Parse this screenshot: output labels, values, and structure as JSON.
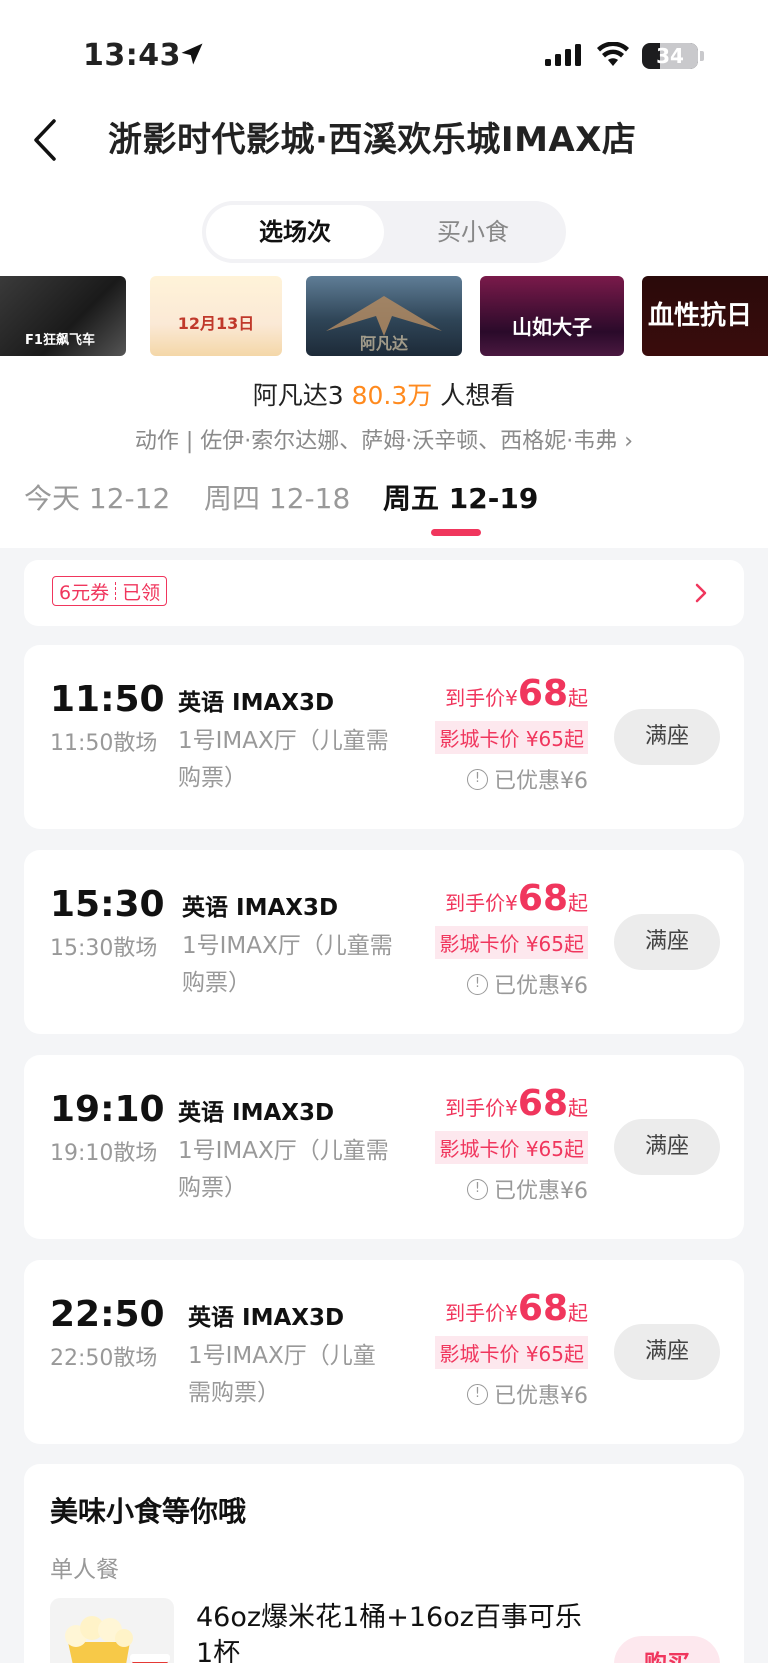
{
  "status_bar": {
    "time": "13:43",
    "battery": "34"
  },
  "header": {
    "title": "浙影时代影城·西溪欢乐城IMAX店"
  },
  "segments": {
    "active": "选场次",
    "inactive": "买小食"
  },
  "posters": [
    {
      "label": "F1狂飙飞车"
    },
    {
      "label": "12月13日"
    },
    {
      "label": "阿凡达"
    },
    {
      "label": "山如大子"
    },
    {
      "label": "血性抗日"
    }
  ],
  "movie": {
    "name": "阿凡达3",
    "want_count": "80.3万",
    "want_suffix": "人想看",
    "info": "动作 | 佐伊·索尔达娜、萨姆·沃辛顿、西格妮·韦弗 ›"
  },
  "date_tabs": [
    {
      "label": "今天 12-12"
    },
    {
      "label": "周四 12-18"
    },
    {
      "label": "周五 12-19"
    }
  ],
  "coupon": {
    "amount": "6元券",
    "status": "已领"
  },
  "shows": [
    {
      "start": "11:50",
      "end": "11:50散场",
      "lang": "英语 IMAX3D",
      "hall": "1号IMAX厅（儿童需购票）",
      "price_prefix": "到手价¥",
      "price": "68",
      "price_suffix": "起",
      "card_price": "影城卡价 ¥65起",
      "discount": "已优惠¥6",
      "state": "满座"
    },
    {
      "start": "15:30",
      "end": "15:30散场",
      "lang": "英语 IMAX3D",
      "hall": "1号IMAX厅（儿童需购票）",
      "price_prefix": "到手价¥",
      "price": "68",
      "price_suffix": "起",
      "card_price": "影城卡价 ¥65起",
      "discount": "已优惠¥6",
      "state": "满座"
    },
    {
      "start": "19:10",
      "end": "19:10散场",
      "lang": "英语 IMAX3D",
      "hall": "1号IMAX厅（儿童需购票）",
      "price_prefix": "到手价¥",
      "price": "68",
      "price_suffix": "起",
      "card_price": "影城卡价 ¥65起",
      "discount": "已优惠¥6",
      "state": "满座"
    },
    {
      "start": "22:50",
      "end": "22:50散场",
      "lang": "英语 IMAX3D",
      "hall": "1号IMAX厅（儿童需购票）",
      "price_prefix": "到手价¥",
      "price": "68",
      "price_suffix": "起",
      "card_price": "影城卡价 ¥65起",
      "discount": "已优惠¥6",
      "state": "满座"
    }
  ],
  "snacks": {
    "title": "美味小食等你哦",
    "category": "单人餐",
    "item_name": "46oz爆米花1桶+16oz百事可乐1杯",
    "buy_label": "购买"
  },
  "colors": {
    "accent": "#f0365d",
    "hot": "#ff8a1e"
  }
}
